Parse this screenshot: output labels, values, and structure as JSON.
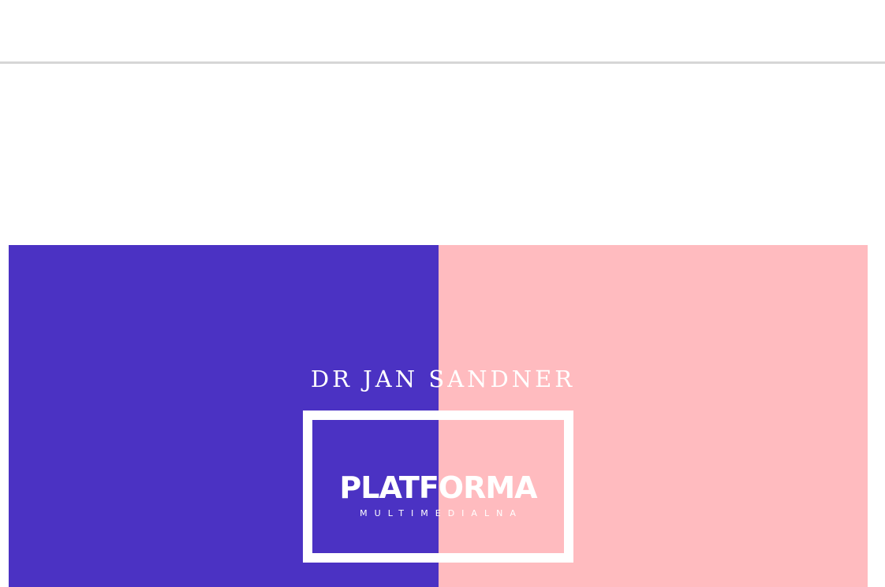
{
  "hero": {
    "author": "DR JAN SANDNER",
    "logo": {
      "title": "PLATFORMA",
      "subtitle": "MULTIMEDIALNA"
    },
    "colors": {
      "left": "#4b32c3",
      "right": "#ffbbbf",
      "text": "#ffffff"
    }
  },
  "chrome": {
    "divider_color": "#d6d6d6",
    "background": "#ffffff"
  }
}
